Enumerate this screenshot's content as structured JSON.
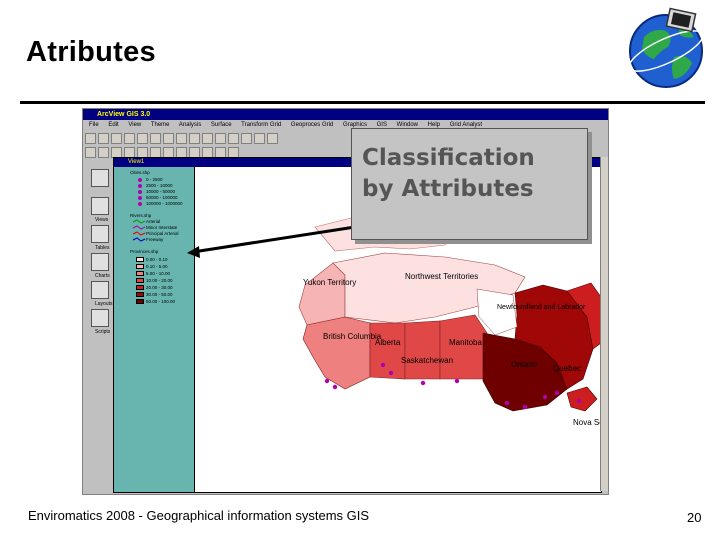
{
  "slide": {
    "title": "Atributes",
    "footer": "Enviromatics 2008 - Geographical information systems GIS",
    "page_number": "20"
  },
  "app": {
    "title_bar": "ArcView GIS 3.0",
    "menu": [
      "File",
      "Edit",
      "View",
      "Theme",
      "Analysis",
      "Surface",
      "Transform Grid",
      "Geoproces Grid",
      "Graphics",
      "GIS",
      "Window",
      "Help",
      "Grid Analyst"
    ],
    "view_title": "View1",
    "left_buttons": [
      "Views",
      "Tables",
      "Charts",
      "Layouts",
      "Scripts"
    ]
  },
  "toc": {
    "themes": [
      {
        "name": "Cities.shp",
        "classes": [
          "0 - 2500",
          "2500 - 10000",
          "10000 - 50000",
          "50000 - 100000",
          "100000 - 1000000"
        ],
        "symbol": "dot"
      },
      {
        "name": "Rivers.shp",
        "classes": [
          "Arterial",
          "Minor Interstate",
          "Principal Arterial",
          "Freeway"
        ],
        "symbol": "line"
      },
      {
        "name": "Provinces.shp",
        "classes": [
          "0.00 - 0.10",
          "0.10 - 5.00",
          "5.00 - 10.00",
          "10.00 - 20.00",
          "20.00 - 30.00",
          "30.00 - 50.00",
          "50.00 - 100.00"
        ],
        "colors": [
          "#fde0e0",
          "#f7b4b4",
          "#ef8080",
          "#e04848",
          "#cc1e1e",
          "#a00808",
          "#6e0000"
        ],
        "symbol": "fill"
      }
    ]
  },
  "map": {
    "labels": {
      "yukon": "Yukon Territory",
      "nwt": "Northwest Territories",
      "bc": "British Columbia",
      "alberta": "Alberta",
      "sask": "Saskatchewan",
      "manitoba": "Manitoba",
      "ontario": "Ontario",
      "quebec": "Quebec",
      "nfld": "Newfoundland and Labrador",
      "ns": "Nova Scotia"
    },
    "province_colors": {
      "yukon": "#f7b4b4",
      "nwt": "#fde0e0",
      "bc": "#ef8080",
      "alberta": "#e04848",
      "sask": "#e04848",
      "manitoba": "#e04848",
      "ontario": "#6e0000",
      "quebec": "#a00808",
      "nfld": "#cc1e1e",
      "maritimes": "#cc1e1e",
      "islands": "#fde0e0"
    },
    "city_color": "#b000b0"
  },
  "callout": {
    "line1": "Classification",
    "line2": "by Attributes"
  }
}
